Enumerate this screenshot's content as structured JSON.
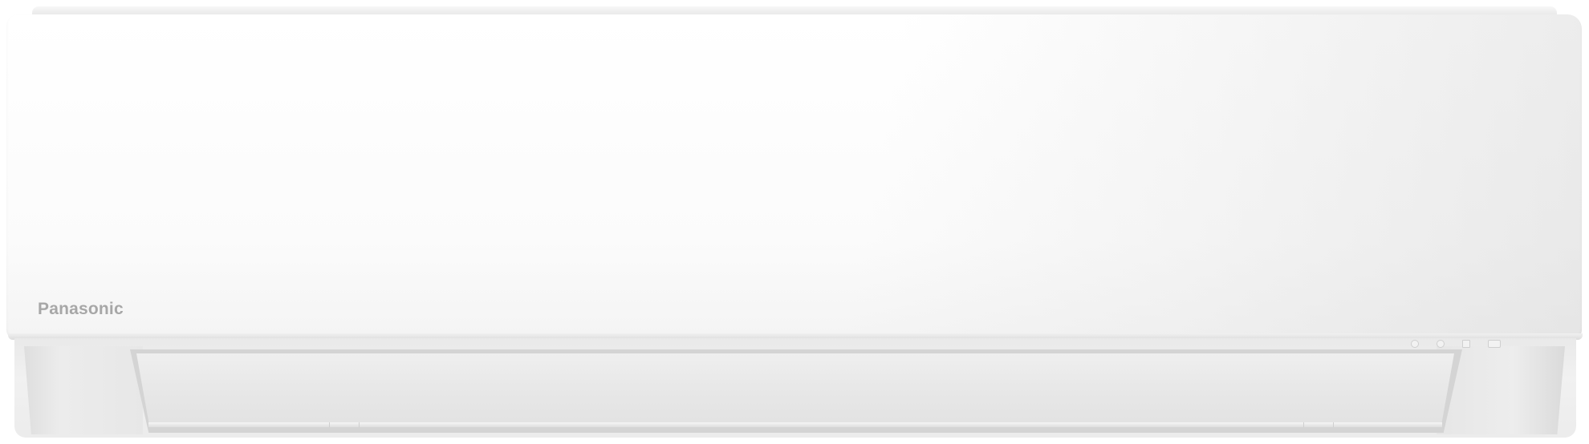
{
  "product": {
    "brand_logo": "Panasonic"
  },
  "colors": {
    "body": "#ffffff",
    "logo": "#a7a7a7",
    "louver": "#e6e6e6"
  },
  "indicators": [
    {
      "icon": "power-indicator-icon"
    },
    {
      "icon": "timer-indicator-icon"
    },
    {
      "icon": "mode-indicator-icon"
    },
    {
      "icon": "signal-indicator-icon"
    }
  ]
}
